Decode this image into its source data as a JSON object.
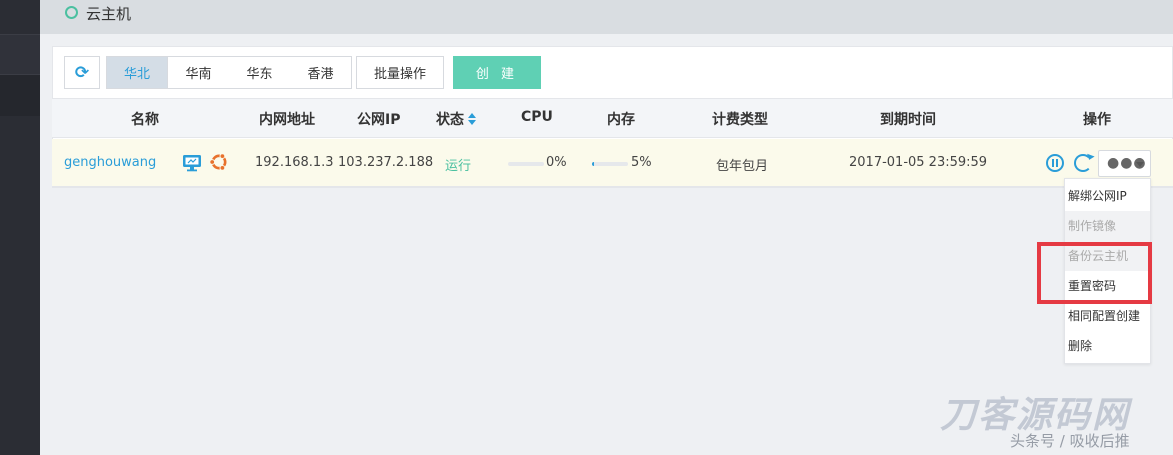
{
  "header": {
    "title": "云主机"
  },
  "toolbar": {
    "regions": [
      "华北",
      "华南",
      "华东",
      "香港"
    ],
    "active_region": "华北",
    "batch_label": "批量操作",
    "create_label": "创 建"
  },
  "table": {
    "columns": {
      "name": "名称",
      "private_ip": "内网地址",
      "public_ip": "公网IP",
      "status": "状态",
      "cpu": "CPU",
      "memory": "内存",
      "billing": "计费类型",
      "expire": "到期时间",
      "actions": "操作"
    },
    "rows": [
      {
        "name": "genghouwang",
        "private_ip": "192.168.1.3",
        "public_ip": "103.237.2.188",
        "status": "运行",
        "cpu": "0%",
        "cpu_value": 0,
        "memory": "5%",
        "memory_value": 5,
        "billing": "包年包月",
        "expire": "2017-01-05 23:59:59",
        "os_icon": "ubuntu-icon",
        "console_icon": "monitor-icon"
      }
    ]
  },
  "menu": {
    "items": [
      "解绑公网IP",
      "制作镜像",
      "备份云主机",
      "重置密码",
      "相同配置创建",
      "删除"
    ]
  },
  "watermark": {
    "main": "刀客源码网",
    "sub": "头条号 / 吸收后推"
  },
  "colors": {
    "accent": "#2a9dd8",
    "create": "#5fd0b4",
    "running": "#4bc0a0",
    "highlight": "#e53a43"
  }
}
